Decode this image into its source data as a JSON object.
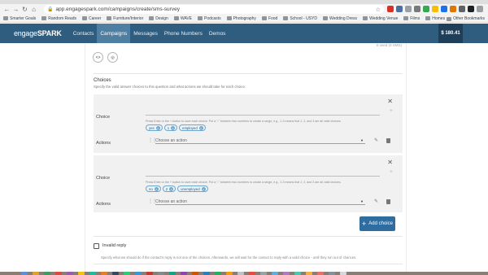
{
  "browser": {
    "url": "app.engagespark.com/campaigns/create/sms-survey",
    "bookmarks": [
      "Smarter Goals",
      "Random Reads",
      "Career",
      "Furniture/Interior",
      "Design",
      "WAVE",
      "Podcasts",
      "Photography",
      "Food",
      "School - USYD",
      "Wedding Dress",
      "Wedding Venue",
      "Films",
      "Homes"
    ],
    "other_bookmarks": "Other Bookmarks"
  },
  "app": {
    "logo_light": "engage",
    "logo_bold": "SPARK",
    "nav": [
      "Contacts",
      "Campaigns",
      "Messages",
      "Phone Numbers",
      "Demos"
    ],
    "active_nav": "Campaigns",
    "balance": "$ 180.41"
  },
  "form": {
    "used_count": "0 used (0 SMS)",
    "choices_title": "Choices",
    "choices_desc": "Specify the valid answer choices to this question and what actions we should take for each choice.",
    "choices": [
      {
        "choice_label": "Choice",
        "hint": "Press Enter or the + button to save each choice. Put a \"-\" between two numbers to create a range, e.g., 1-3 means that 1, 2, and 3 are all valid choices.",
        "tags": [
          "yes",
          "1",
          "employed"
        ],
        "actions_label": "Actions",
        "action_placeholder": "Choose an action"
      },
      {
        "choice_label": "Choice",
        "hint": "Press Enter or the + button to save each choice. Put a \"-\" between two numbers to create a range, e.g., 1-3 means that 1, 2, and 3 are all valid choices.",
        "tags": [
          "no",
          "2",
          "unemployed"
        ],
        "actions_label": "Actions",
        "action_placeholder": "Choose an action"
      }
    ],
    "add_choice_label": "Add choice",
    "invalid_reply_label": "Invalid reply",
    "invalid_reply_desc": "Specify what we should do if the contact's reply is not one of the choices. Afterwards, we will wait for the contact to reply with a valid choice - until they run out of chances."
  },
  "colors": {
    "nav_bg": "#2f5d80",
    "accent": "#2f6da0"
  }
}
